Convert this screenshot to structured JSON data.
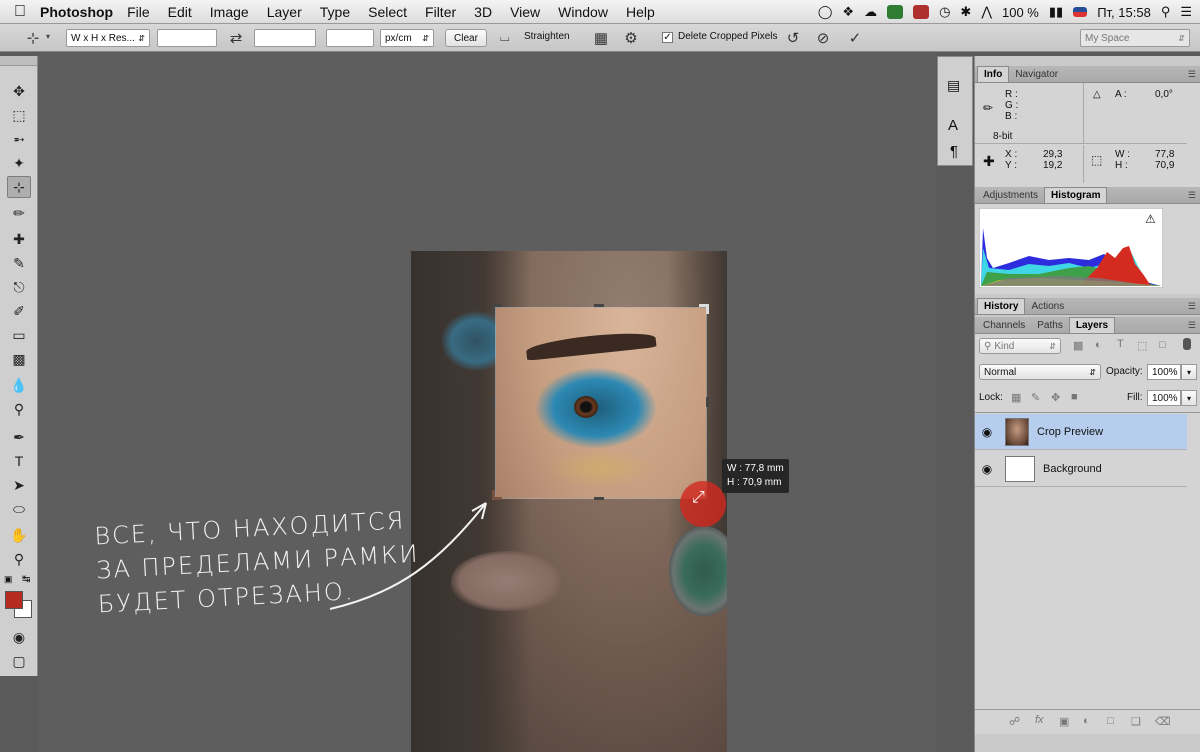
{
  "menubar": {
    "app_name": "Photoshop",
    "menus": [
      "File",
      "Edit",
      "Image",
      "Layer",
      "Type",
      "Select",
      "Filter",
      "3D",
      "View",
      "Window",
      "Help"
    ],
    "battery": "100 %",
    "clock": "Пт, 15:58"
  },
  "options_bar": {
    "ratio_preset": "W x H x Res...",
    "width_value": "",
    "height_value": "",
    "resolution_value": "",
    "unit": "px/cm",
    "clear_label": "Clear",
    "straighten_label": "Straighten",
    "delete_cropped_label": "Delete Cropped Pixels",
    "delete_cropped_checked": true,
    "workspace": "My Space"
  },
  "canvas": {
    "crop_tooltip": {
      "width": "W : 77,8 mm",
      "height": "H : 70,9 mm"
    },
    "annotation_lines": [
      "ВСЕ, ЧТО НАХОДИТСЯ",
      "ЗА ПРЕДЕЛАМИ РАМКИ",
      "БУДЕТ ОТРЕЗАНО."
    ]
  },
  "info_panel": {
    "tabs": [
      "Info",
      "Navigator"
    ],
    "rgb_labels": [
      "R :",
      "G :",
      "B :"
    ],
    "bit_depth": "8-bit",
    "angle_label": "A :",
    "angle_value": "0,0°",
    "x_label": "X :",
    "x_value": "29,3",
    "y_label": "Y :",
    "y_value": "19,2",
    "w_label": "W :",
    "w_value": "77,8",
    "h_label": "H :",
    "h_value": "70,9"
  },
  "histogram_panel": {
    "tabs": [
      "Adjustments",
      "Histogram"
    ],
    "warning_icon": "warning-icon"
  },
  "history_panel": {
    "tabs": [
      "History",
      "Actions"
    ]
  },
  "layers_panel": {
    "tabs": [
      "Channels",
      "Paths",
      "Layers"
    ],
    "filter_placeholder": "Kind",
    "blend_mode": "Normal",
    "opacity_label": "Opacity:",
    "opacity_value": "100%",
    "lock_label": "Lock:",
    "fill_label": "Fill:",
    "fill_value": "100%",
    "layers": [
      {
        "name": "Crop Preview",
        "selected": true
      },
      {
        "name": "Background",
        "selected": false
      }
    ]
  },
  "colors": {
    "foreground": "#b52b1f",
    "background": "#ffffff",
    "selection": "#b6cdee"
  }
}
